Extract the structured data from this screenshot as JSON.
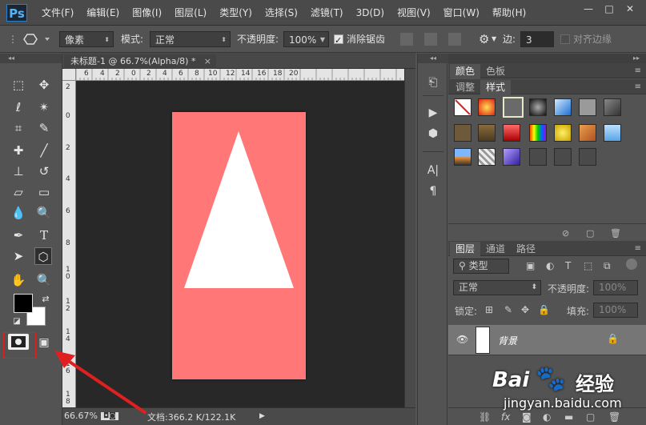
{
  "app": {
    "logo": "Ps"
  },
  "menu": [
    "文件(F)",
    "编辑(E)",
    "图像(I)",
    "图层(L)",
    "类型(Y)",
    "选择(S)",
    "滤镜(T)",
    "3D(D)",
    "视图(V)",
    "窗口(W)",
    "帮助(H)"
  ],
  "window_controls": {
    "minimize": "—",
    "maximize": "□",
    "close": "✕"
  },
  "options": {
    "mode_unit": "像素",
    "mode_label": "模式:",
    "mode_value": "正常",
    "opacity_label": "不透明度:",
    "opacity_value": "100%",
    "antialias_label": "消除锯齿",
    "antialias_checked": true,
    "sides_label": "边:",
    "sides_value": "3",
    "align_edges_label": "对齐边缘",
    "align_edges_checked": false
  },
  "document": {
    "tab_title": "未标题-1 @ 66.7%(Alpha/8) *",
    "tab_close": "×",
    "canvas_color": "#ff7777",
    "triangle_color": "#ffffff",
    "ruler_top_labels": [
      "6",
      "4",
      "2",
      "0",
      "2",
      "4",
      "6",
      "8",
      "10",
      "12",
      "14",
      "16",
      "18",
      "20"
    ],
    "ruler_left_labels": [
      "2",
      "0",
      "2",
      "4",
      "6",
      "8",
      "1 0",
      "1 2",
      "1 4",
      "1 6",
      "1 8"
    ]
  },
  "status": {
    "zoom": "66.67%",
    "doc_info": "文档:366.2 K/122.1K"
  },
  "tools": {
    "icons": [
      "marquee-icon",
      "move-icon",
      "lasso-icon",
      "magic-wand-icon",
      "crop-icon",
      "eyedropper-icon",
      "healing-brush-icon",
      "brush-icon",
      "clone-stamp-icon",
      "history-brush-icon",
      "eraser-icon",
      "gradient-icon",
      "blur-icon",
      "dodge-icon",
      "pen-icon",
      "type-icon",
      "path-selection-icon",
      "shape-icon",
      "hand-icon",
      "zoom-icon"
    ]
  },
  "panels": {
    "color_tabs": [
      "颜色",
      "色板"
    ],
    "style_tabs": [
      "调整",
      "样式"
    ],
    "layer_tabs": [
      "图层",
      "通道",
      "路径"
    ],
    "layer_filter": "类型",
    "blend_mode": "正常",
    "opacity_label": "不透明度:",
    "opacity_value": "100%",
    "lock_label": "锁定:",
    "fill_label": "填充:",
    "fill_value": "100%",
    "layer_name": "背景"
  },
  "colors": {
    "accent": "#e02020",
    "ps_blue": "#53b3f5"
  },
  "watermark": {
    "brand": "Bai",
    "brand_suffix": "经验",
    "url": "jingyan.baidu.com"
  }
}
